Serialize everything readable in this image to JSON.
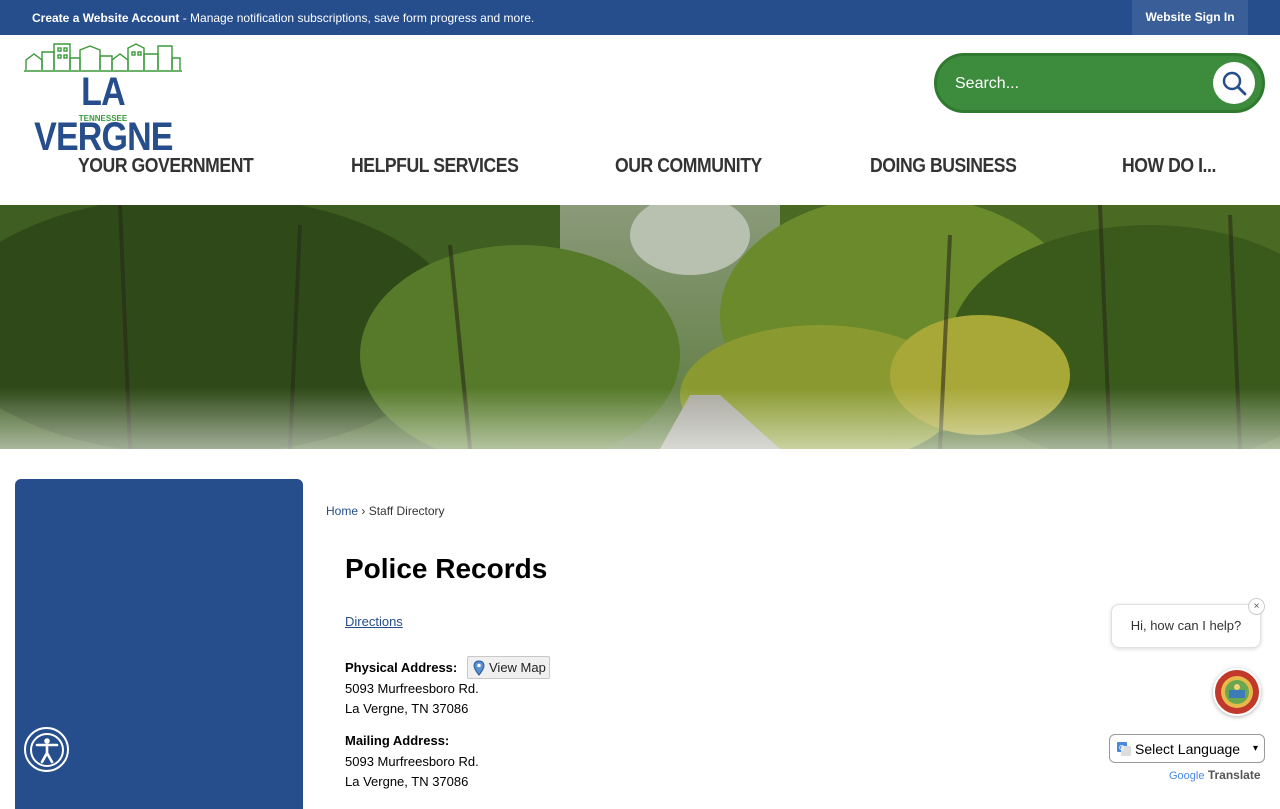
{
  "topbar": {
    "create_bold": "Create a Website Account",
    "create_rest": " - Manage notification subscriptions, save form progress and more.",
    "signin": "Website Sign In"
  },
  "logo": {
    "name": "LA VERGNE",
    "state": "TENNESSEE"
  },
  "search": {
    "placeholder": "Search..."
  },
  "nav": [
    "YOUR GOVERNMENT",
    "HELPFUL SERVICES",
    "OUR COMMUNITY",
    "DOING BUSINESS",
    "HOW DO I..."
  ],
  "breadcrumb": {
    "home": "Home",
    "sep": "›",
    "current": "Staff Directory"
  },
  "page": {
    "title": "Police Records",
    "directions": "Directions",
    "physical_label": "Physical Address:",
    "view_map": "View Map",
    "physical_line1": "5093 Murfreesboro Rd.",
    "physical_line2": "La Vergne, TN 37086",
    "mailing_label": "Mailing Address:",
    "mailing_line1": "5093 Murfreesboro Rd.",
    "mailing_line2": "La Vergne, TN 37086"
  },
  "chat": {
    "greeting": "Hi, how can I help?",
    "close": "×"
  },
  "translate": {
    "select": "Select Language",
    "google": "Google",
    "translate": "Translate"
  },
  "colors": {
    "brand_blue": "#264e8c",
    "brand_green": "#3d8b3d"
  }
}
